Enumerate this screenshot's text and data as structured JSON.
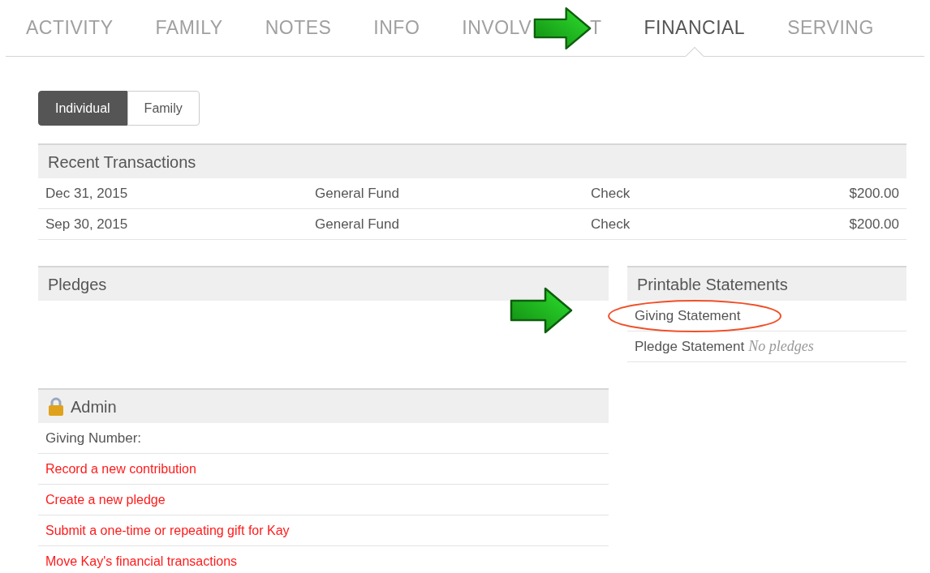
{
  "tabs": [
    {
      "label": "ACTIVITY",
      "selected": false
    },
    {
      "label": "FAMILY",
      "selected": false
    },
    {
      "label": "NOTES",
      "selected": false
    },
    {
      "label": "INFO",
      "selected": false
    },
    {
      "label": "INVOLV",
      "label_tail": "T",
      "selected": false
    },
    {
      "label": "FINANCIAL",
      "selected": true
    },
    {
      "label": "SERVING",
      "selected": false
    }
  ],
  "scope_toggle": [
    {
      "label": "Individual",
      "selected": true
    },
    {
      "label": "Family",
      "selected": false
    }
  ],
  "recent_transactions": {
    "title": "Recent Transactions",
    "rows": [
      {
        "date": "Dec 31, 2015",
        "fund": "General Fund",
        "method": "Check",
        "amount": "$200.00"
      },
      {
        "date": "Sep 30, 2015",
        "fund": "General Fund",
        "method": "Check",
        "amount": "$200.00"
      }
    ]
  },
  "pledges": {
    "title": "Pledges"
  },
  "printable_statements": {
    "title": "Printable Statements",
    "items": [
      {
        "label": "Giving Statement",
        "circled": true
      },
      {
        "label": "Pledge Statement",
        "note": "No pledges",
        "circled": false
      }
    ]
  },
  "admin": {
    "title": "Admin",
    "rows": [
      {
        "kind": "text",
        "label": "Giving Number:"
      },
      {
        "kind": "link",
        "label": "Record a new contribution"
      },
      {
        "kind": "link",
        "label": "Create a new pledge"
      },
      {
        "kind": "link",
        "label": "Submit a one-time or repeating gift for Kay"
      },
      {
        "kind": "link",
        "label": "Move Kay's financial transactions"
      }
    ]
  }
}
